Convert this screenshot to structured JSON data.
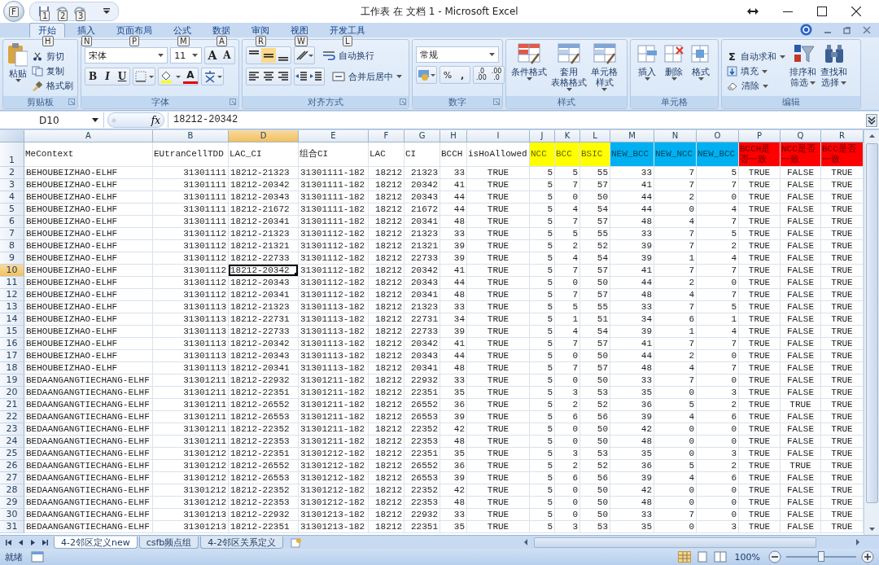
{
  "window": {
    "title": "工作表 在 文档 1 - Microsoft Excel",
    "office_keytip": "F",
    "quick_access_keytips": [
      "1",
      "2",
      "3"
    ]
  },
  "tabs": [
    {
      "label": "开始",
      "keytip": "H",
      "selected": true
    },
    {
      "label": "插入",
      "keytip": "N",
      "selected": false
    },
    {
      "label": "页面布局",
      "keytip": "P",
      "selected": false
    },
    {
      "label": "公式",
      "keytip": "M",
      "selected": false
    },
    {
      "label": "数据",
      "keytip": "A",
      "selected": false
    },
    {
      "label": "审阅",
      "keytip": "R",
      "selected": false
    },
    {
      "label": "视图",
      "keytip": "W",
      "selected": false
    },
    {
      "label": "开发工具",
      "keytip": "L",
      "selected": false
    }
  ],
  "ribbon": {
    "clipboard": {
      "label": "剪贴板",
      "paste": "粘贴",
      "small": [
        "剪切",
        "复制",
        "格式刷"
      ]
    },
    "font": {
      "label": "字体",
      "font": "宋体",
      "size": "11",
      "grow": "A",
      "shrink": "A",
      "bold": "B",
      "italic": "I",
      "underline": "U",
      "font_color": "A"
    },
    "alignment": {
      "label": "对齐方式",
      "vertical": [
        {
          "selected": false
        },
        {
          "selected": true
        },
        {
          "selected": false
        }
      ],
      "wrap": "自动换行",
      "merge": "合并后居中"
    },
    "number": {
      "label": "数字",
      "format": "常规",
      "percent": "%",
      "comma": ",",
      "inc_decimal": [
        ".0",
        ".00"
      ],
      "dec_decimal": [
        ".00",
        ".0"
      ]
    },
    "styles": {
      "label": "样式",
      "buttons": [
        {
          "lines": [
            "条件格式"
          ]
        },
        {
          "lines": [
            "套用",
            "表格格式"
          ]
        },
        {
          "lines": [
            "单元格",
            "样式"
          ]
        }
      ]
    },
    "cells": {
      "label": "单元格",
      "buttons": [
        "插入",
        "删除",
        "格式"
      ]
    },
    "editing": {
      "label": "编辑",
      "sum_symbol": "Σ",
      "small": [
        "自动求和",
        "填充",
        "清除"
      ],
      "large": [
        [
          "排序和",
          "筛选"
        ],
        [
          "查找和",
          "选择"
        ]
      ]
    }
  },
  "formula_bar": {
    "name_box": "D10",
    "fx": "fx",
    "value": "18212-20342"
  },
  "sheet": {
    "columns": [
      {
        "letter": "A",
        "selected": false
      },
      {
        "letter": "B",
        "selected": false
      },
      {
        "letter": "D",
        "selected": true
      },
      {
        "letter": "E",
        "selected": false
      },
      {
        "letter": "F",
        "selected": false
      },
      {
        "letter": "G",
        "selected": false
      },
      {
        "letter": "H",
        "selected": false
      },
      {
        "letter": "I",
        "selected": false
      },
      {
        "letter": "J",
        "selected": false
      },
      {
        "letter": "K",
        "selected": false
      },
      {
        "letter": "L",
        "selected": false
      },
      {
        "letter": "M",
        "selected": false
      },
      {
        "letter": "N",
        "selected": false
      },
      {
        "letter": "O",
        "selected": false
      },
      {
        "letter": "P",
        "selected": false
      },
      {
        "letter": "Q",
        "selected": false
      },
      {
        "letter": "R",
        "selected": false
      }
    ],
    "header_row": {
      "n": "1",
      "cells": [
        {
          "text": "MeContext"
        },
        {
          "text": "EUtranCellTDD"
        },
        {
          "text": "LAC_CI"
        },
        {
          "text": "组合CI"
        },
        {
          "text": "LAC"
        },
        {
          "text": "CI"
        },
        {
          "text": "BCCH"
        },
        {
          "text": "isHoAllowed"
        },
        {
          "text": "NCC",
          "color": "#ffff00"
        },
        {
          "text": "BCC",
          "color": "#ffff00"
        },
        {
          "text": "BSIC",
          "color": "#ffff00"
        },
        {
          "text": "NEW_BCC",
          "color": "#00b0f0"
        },
        {
          "text": "NEW_NCC",
          "color": "#00b0f0"
        },
        {
          "text": "NEW_BCC",
          "color": "#00b0f0"
        },
        {
          "text": "BCCH是否一致",
          "color": "#ff0000"
        },
        {
          "text": "NCC是否一致",
          "color": "#ff0000"
        },
        {
          "text": "BCC是否一致",
          "color": "#ff0000"
        }
      ]
    },
    "rows": [
      {
        "n": "2",
        "selected": false,
        "cells": [
          "BEHOUBEIZHAO-ELHF",
          "31301111",
          "18212-21323",
          "31301111-182",
          "18212",
          "21323",
          "33",
          "TRUE",
          "5",
          "5",
          "55",
          "33",
          "7",
          "5",
          "TRUE",
          "FALSE",
          "TRUE"
        ]
      },
      {
        "n": "3",
        "selected": false,
        "cells": [
          "BEHOUBEIZHAO-ELHF",
          "31301111",
          "18212-20342",
          "31301111-182",
          "18212",
          "20342",
          "41",
          "TRUE",
          "5",
          "7",
          "57",
          "41",
          "7",
          "7",
          "TRUE",
          "FALSE",
          "TRUE"
        ]
      },
      {
        "n": "4",
        "selected": false,
        "cells": [
          "BEHOUBEIZHAO-ELHF",
          "31301111",
          "18212-20343",
          "31301111-182",
          "18212",
          "20343",
          "44",
          "TRUE",
          "5",
          "0",
          "50",
          "44",
          "2",
          "0",
          "TRUE",
          "FALSE",
          "TRUE"
        ]
      },
      {
        "n": "5",
        "selected": false,
        "cells": [
          "BEHOUBEIZHAO-ELHF",
          "31301111",
          "18212-21672",
          "31301111-182",
          "18212",
          "21672",
          "44",
          "TRUE",
          "5",
          "4",
          "54",
          "44",
          "0",
          "4",
          "TRUE",
          "FALSE",
          "TRUE"
        ]
      },
      {
        "n": "6",
        "selected": false,
        "cells": [
          "BEHOUBEIZHAO-ELHF",
          "31301111",
          "18212-20341",
          "31301111-182",
          "18212",
          "20341",
          "48",
          "TRUE",
          "5",
          "7",
          "57",
          "48",
          "4",
          "7",
          "TRUE",
          "FALSE",
          "TRUE"
        ]
      },
      {
        "n": "7",
        "selected": false,
        "cells": [
          "BEHOUBEIZHAO-ELHF",
          "31301112",
          "18212-21323",
          "31301112-182",
          "18212",
          "21323",
          "33",
          "TRUE",
          "5",
          "5",
          "55",
          "33",
          "7",
          "5",
          "TRUE",
          "FALSE",
          "TRUE"
        ]
      },
      {
        "n": "8",
        "selected": false,
        "cells": [
          "BEHOUBEIZHAO-ELHF",
          "31301112",
          "18212-21321",
          "31301112-182",
          "18212",
          "21321",
          "39",
          "TRUE",
          "5",
          "2",
          "52",
          "39",
          "7",
          "2",
          "TRUE",
          "FALSE",
          "TRUE"
        ]
      },
      {
        "n": "9",
        "selected": false,
        "cells": [
          "BEHOUBEIZHAO-ELHF",
          "31301112",
          "18212-22733",
          "31301112-182",
          "18212",
          "22733",
          "39",
          "TRUE",
          "5",
          "4",
          "54",
          "39",
          "1",
          "4",
          "TRUE",
          "FALSE",
          "TRUE"
        ]
      },
      {
        "n": "10",
        "selected": true,
        "cells": [
          "BEHOUBEIZHAO-ELHF",
          "31301112",
          "18212-20342",
          "31301112-182",
          "18212",
          "20342",
          "41",
          "TRUE",
          "5",
          "7",
          "57",
          "41",
          "7",
          "7",
          "TRUE",
          "FALSE",
          "TRUE"
        ]
      },
      {
        "n": "11",
        "selected": false,
        "cells": [
          "BEHOUBEIZHAO-ELHF",
          "31301112",
          "18212-20343",
          "31301112-182",
          "18212",
          "20343",
          "44",
          "TRUE",
          "5",
          "0",
          "50",
          "44",
          "2",
          "0",
          "TRUE",
          "FALSE",
          "TRUE"
        ]
      },
      {
        "n": "12",
        "selected": false,
        "cells": [
          "BEHOUBEIZHAO-ELHF",
          "31301112",
          "18212-20341",
          "31301112-182",
          "18212",
          "20341",
          "48",
          "TRUE",
          "5",
          "7",
          "57",
          "48",
          "4",
          "7",
          "TRUE",
          "FALSE",
          "TRUE"
        ]
      },
      {
        "n": "13",
        "selected": false,
        "cells": [
          "BEHOUBEIZHAO-ELHF",
          "31301113",
          "18212-21323",
          "31301113-182",
          "18212",
          "21323",
          "33",
          "TRUE",
          "5",
          "5",
          "55",
          "33",
          "7",
          "5",
          "TRUE",
          "FALSE",
          "TRUE"
        ]
      },
      {
        "n": "14",
        "selected": false,
        "cells": [
          "BEHOUBEIZHAO-ELHF",
          "31301113",
          "18212-22731",
          "31301113-182",
          "18212",
          "22731",
          "34",
          "TRUE",
          "5",
          "1",
          "51",
          "34",
          "6",
          "1",
          "TRUE",
          "FALSE",
          "TRUE"
        ]
      },
      {
        "n": "15",
        "selected": false,
        "cells": [
          "BEHOUBEIZHAO-ELHF",
          "31301113",
          "18212-22733",
          "31301113-182",
          "18212",
          "22733",
          "39",
          "TRUE",
          "5",
          "4",
          "54",
          "39",
          "1",
          "4",
          "TRUE",
          "FALSE",
          "TRUE"
        ]
      },
      {
        "n": "16",
        "selected": false,
        "cells": [
          "BEHOUBEIZHAO-ELHF",
          "31301113",
          "18212-20342",
          "31301113-182",
          "18212",
          "20342",
          "41",
          "TRUE",
          "5",
          "7",
          "57",
          "41",
          "7",
          "7",
          "TRUE",
          "FALSE",
          "TRUE"
        ]
      },
      {
        "n": "17",
        "selected": false,
        "cells": [
          "BEHOUBEIZHAO-ELHF",
          "31301113",
          "18212-20343",
          "31301113-182",
          "18212",
          "20343",
          "44",
          "TRUE",
          "5",
          "0",
          "50",
          "44",
          "2",
          "0",
          "TRUE",
          "FALSE",
          "TRUE"
        ]
      },
      {
        "n": "18",
        "selected": false,
        "cells": [
          "BEHOUBEIZHAO-ELHF",
          "31301113",
          "18212-20341",
          "31301113-182",
          "18212",
          "20341",
          "48",
          "TRUE",
          "5",
          "7",
          "57",
          "48",
          "4",
          "7",
          "TRUE",
          "FALSE",
          "TRUE"
        ]
      },
      {
        "n": "19",
        "selected": false,
        "cells": [
          "BEDAANGANGTIECHANG-ELHF",
          "31301211",
          "18212-22932",
          "31301211-182",
          "18212",
          "22932",
          "33",
          "TRUE",
          "5",
          "0",
          "50",
          "33",
          "7",
          "0",
          "TRUE",
          "FALSE",
          "TRUE"
        ]
      },
      {
        "n": "20",
        "selected": false,
        "cells": [
          "BEDAANGANGTIECHANG-ELHF",
          "31301211",
          "18212-22351",
          "31301211-182",
          "18212",
          "22351",
          "35",
          "TRUE",
          "5",
          "3",
          "53",
          "35",
          "0",
          "3",
          "TRUE",
          "FALSE",
          "TRUE"
        ]
      },
      {
        "n": "21",
        "selected": false,
        "cells": [
          "BEDAANGANGTIECHANG-ELHF",
          "31301211",
          "18212-26552",
          "31301211-182",
          "18212",
          "26552",
          "36",
          "TRUE",
          "5",
          "2",
          "52",
          "36",
          "5",
          "2",
          "TRUE",
          "TRUE",
          "TRUE"
        ]
      },
      {
        "n": "22",
        "selected": false,
        "cells": [
          "BEDAANGANGTIECHANG-ELHF",
          "31301211",
          "18212-26553",
          "31301211-182",
          "18212",
          "26553",
          "39",
          "TRUE",
          "5",
          "6",
          "56",
          "39",
          "4",
          "6",
          "TRUE",
          "FALSE",
          "TRUE"
        ]
      },
      {
        "n": "23",
        "selected": false,
        "cells": [
          "BEDAANGANGTIECHANG-ELHF",
          "31301211",
          "18212-22352",
          "31301211-182",
          "18212",
          "22352",
          "42",
          "TRUE",
          "5",
          "0",
          "50",
          "42",
          "0",
          "0",
          "TRUE",
          "FALSE",
          "TRUE"
        ]
      },
      {
        "n": "24",
        "selected": false,
        "cells": [
          "BEDAANGANGTIECHANG-ELHF",
          "31301211",
          "18212-22353",
          "31301211-182",
          "18212",
          "22353",
          "48",
          "TRUE",
          "5",
          "0",
          "50",
          "48",
          "0",
          "0",
          "TRUE",
          "FALSE",
          "TRUE"
        ]
      },
      {
        "n": "25",
        "selected": false,
        "cells": [
          "BEDAANGANGTIECHANG-ELHF",
          "31301212",
          "18212-22351",
          "31301212-182",
          "18212",
          "22351",
          "35",
          "TRUE",
          "5",
          "3",
          "53",
          "35",
          "0",
          "3",
          "TRUE",
          "FALSE",
          "TRUE"
        ]
      },
      {
        "n": "26",
        "selected": false,
        "cells": [
          "BEDAANGANGTIECHANG-ELHF",
          "31301212",
          "18212-26552",
          "31301212-182",
          "18212",
          "26552",
          "36",
          "TRUE",
          "5",
          "2",
          "52",
          "36",
          "5",
          "2",
          "TRUE",
          "TRUE",
          "TRUE"
        ]
      },
      {
        "n": "27",
        "selected": false,
        "cells": [
          "BEDAANGANGTIECHANG-ELHF",
          "31301212",
          "18212-26553",
          "31301212-182",
          "18212",
          "26553",
          "39",
          "TRUE",
          "5",
          "6",
          "56",
          "39",
          "4",
          "6",
          "TRUE",
          "FALSE",
          "TRUE"
        ]
      },
      {
        "n": "28",
        "selected": false,
        "cells": [
          "BEDAANGANGTIECHANG-ELHF",
          "31301212",
          "18212-22352",
          "31301212-182",
          "18212",
          "22352",
          "42",
          "TRUE",
          "5",
          "0",
          "50",
          "42",
          "0",
          "0",
          "TRUE",
          "FALSE",
          "TRUE"
        ]
      },
      {
        "n": "29",
        "selected": false,
        "cells": [
          "BEDAANGANGTIECHANG-ELHF",
          "31301212",
          "18212-22353",
          "31301212-182",
          "18212",
          "22353",
          "48",
          "TRUE",
          "5",
          "0",
          "50",
          "48",
          "0",
          "0",
          "TRUE",
          "FALSE",
          "TRUE"
        ]
      },
      {
        "n": "30",
        "selected": false,
        "cells": [
          "BEDAANGANGTIECHANG-ELHF",
          "31301213",
          "18212-22932",
          "31301213-182",
          "18212",
          "22932",
          "33",
          "TRUE",
          "5",
          "0",
          "50",
          "33",
          "7",
          "0",
          "TRUE",
          "FALSE",
          "TRUE"
        ]
      },
      {
        "n": "31",
        "selected": false,
        "cells": [
          "BEDAANGANGTIECHANG-ELHF",
          "31301213",
          "18212-22351",
          "31301213-182",
          "18212",
          "22351",
          "35",
          "TRUE",
          "5",
          "3",
          "53",
          "35",
          "0",
          "3",
          "TRUE",
          "FALSE",
          "TRUE"
        ]
      }
    ]
  },
  "sheet_tabs": [
    {
      "label": "4-2邻区定义new",
      "selected": true
    },
    {
      "label": "csfb频点组",
      "selected": false
    },
    {
      "label": "4-2邻区关系定义",
      "selected": false
    }
  ],
  "status_bar": {
    "status": "就绪",
    "zoom": "100%",
    "level": 0.5
  }
}
